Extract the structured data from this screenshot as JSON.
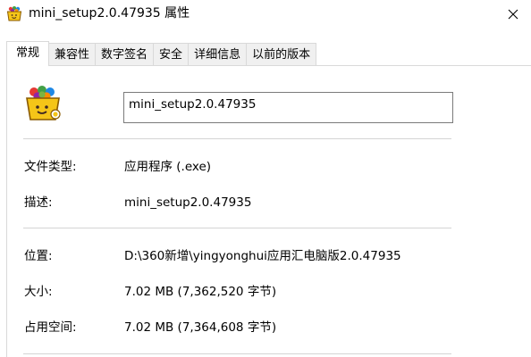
{
  "window": {
    "title": "mini_setup2.0.47935 属性"
  },
  "tabs": [
    {
      "label": "常规",
      "active": true
    },
    {
      "label": "兼容性",
      "active": false
    },
    {
      "label": "数字签名",
      "active": false
    },
    {
      "label": "安全",
      "active": false
    },
    {
      "label": "详细信息",
      "active": false
    },
    {
      "label": "以前的版本",
      "active": false
    }
  ],
  "general": {
    "file_name": "mini_setup2.0.47935",
    "properties": [
      {
        "label": "文件类型:",
        "value": "应用程序 (.exe)"
      },
      {
        "label": "描述:",
        "value": "mini_setup2.0.47935"
      },
      {
        "label": "位置:",
        "value": "D:\\360新增\\yingyonghui应用汇电脑版2.0.47935"
      },
      {
        "label": "大小:",
        "value": "7.02 MB (7,362,520 字节)"
      },
      {
        "label": "占用空间:",
        "value": "7.02 MB (7,364,608 字节)"
      }
    ]
  },
  "icons": {
    "title": "app-basket-icon",
    "close": "close-icon",
    "app": "app-basket-icon"
  },
  "colors": {
    "basket": "#f5c518",
    "tab_bg": "#f0f0f0",
    "border": "#d9d9d9"
  }
}
